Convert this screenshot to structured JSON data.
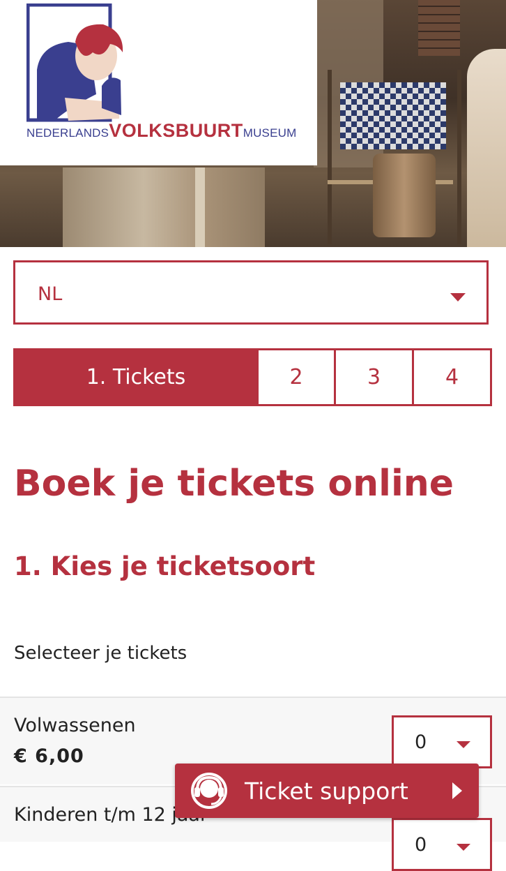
{
  "brand": {
    "logo_prefix": "NEDERLANDS",
    "logo_main": "VOLKSBUURT",
    "logo_suffix": "MUSEUM"
  },
  "language": {
    "selected": "NL"
  },
  "steps": [
    {
      "label": "1. Tickets",
      "active": true
    },
    {
      "label": "2",
      "active": false
    },
    {
      "label": "3",
      "active": false
    },
    {
      "label": "4",
      "active": false
    }
  ],
  "page": {
    "title": "Boek je tickets online",
    "subtitle": "1. Kies je ticketsoort",
    "intro": "Selecteer je tickets"
  },
  "tickets": [
    {
      "name": "Volwassenen",
      "price": "€ 6,00",
      "quantity": "0"
    },
    {
      "name": "Kinderen t/m 12 jaar",
      "quantity": "0"
    }
  ],
  "support": {
    "label": "Ticket support",
    "icon": "headset-icon"
  },
  "colors": {
    "accent": "#b5313f",
    "logo_blue": "#3a3f8f"
  }
}
